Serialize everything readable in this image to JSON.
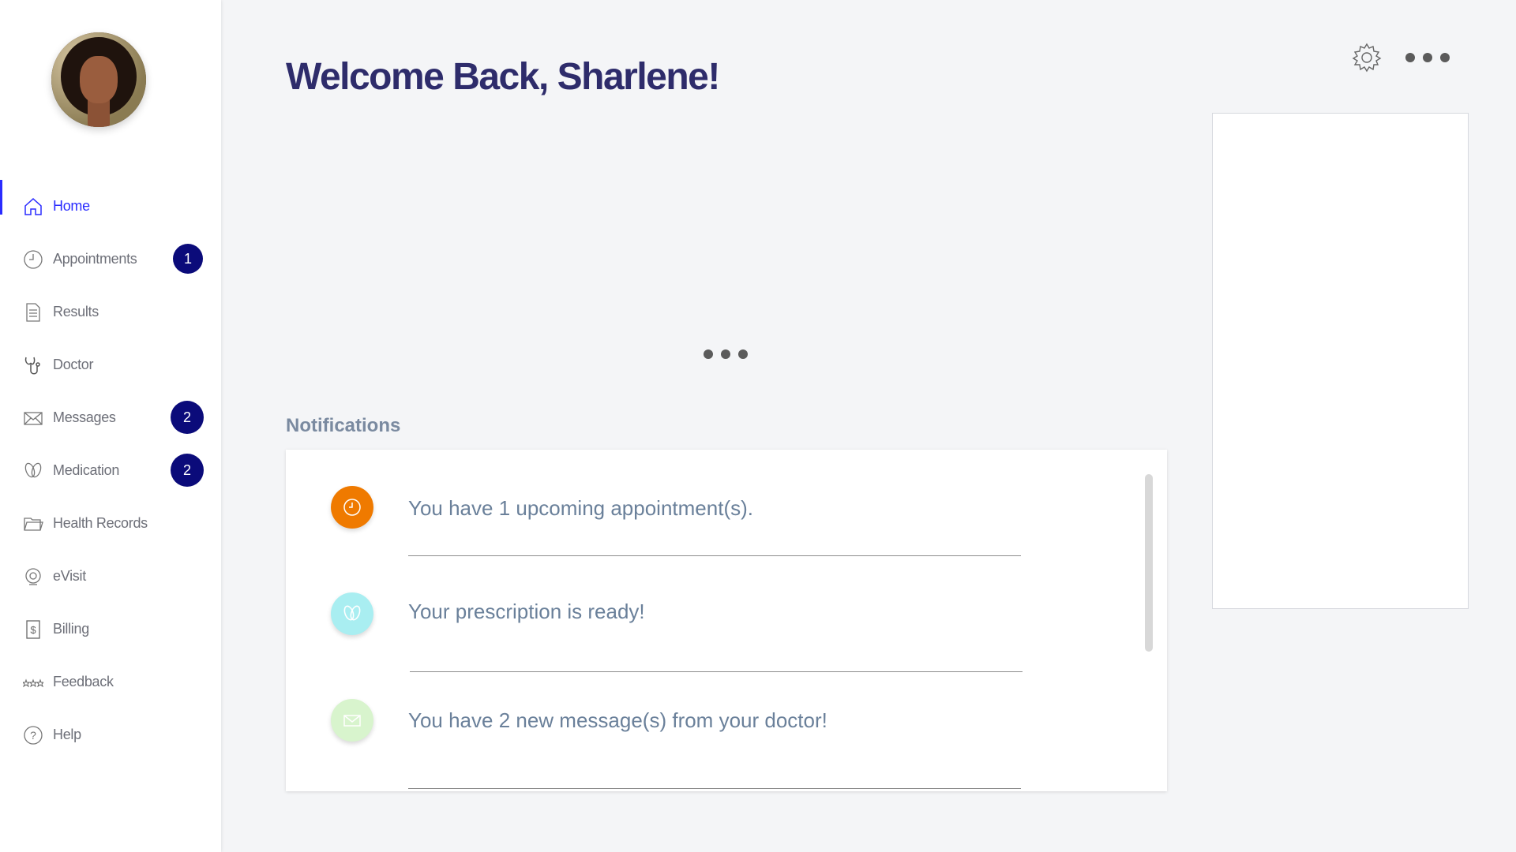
{
  "sidebar": {
    "items": [
      {
        "label": "Home",
        "icon": "home-icon",
        "active": true
      },
      {
        "label": "Appointments",
        "icon": "clock-icon",
        "badge": "1"
      },
      {
        "label": "Results",
        "icon": "document-icon"
      },
      {
        "label": "Doctor",
        "icon": "stethoscope-icon"
      },
      {
        "label": "Messages",
        "icon": "envelope-icon",
        "badge": "2"
      },
      {
        "label": "Medication",
        "icon": "pills-icon",
        "badge": "2"
      },
      {
        "label": "Health Records",
        "icon": "folder-icon"
      },
      {
        "label": "eVisit",
        "icon": "webcam-icon"
      },
      {
        "label": "Billing",
        "icon": "dollar-icon"
      },
      {
        "label": "Feedback",
        "icon": "stars-icon"
      },
      {
        "label": "Help",
        "icon": "question-icon"
      }
    ]
  },
  "header": {
    "title": "Welcome Back, Sharlene!"
  },
  "notifications": {
    "heading": "Notifications",
    "items": [
      {
        "text": "You have 1 upcoming appointment(s).",
        "icon": "clock-icon",
        "color": "#ef7a00"
      },
      {
        "text": "Your prescription is ready!",
        "icon": "pills-icon",
        "color": "#a9eef1"
      },
      {
        "text": "You have 2 new message(s) from your doctor!",
        "icon": "envelope-icon",
        "color": "#d8f4cd"
      }
    ]
  },
  "colors": {
    "accent": "#2a2cff",
    "badge": "#0b0b7a",
    "title": "#2e2c6b"
  }
}
